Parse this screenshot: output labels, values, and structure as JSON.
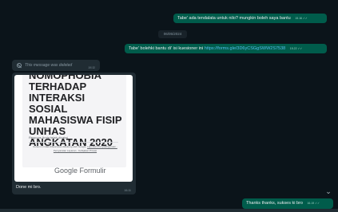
{
  "messages": {
    "out1": {
      "text": "Tabe' ada tendalata untuk nilo? mungkin boleh saya bantu",
      "time": "15.16 ✓✓"
    },
    "date_chip": "06/05/2024",
    "out2": {
      "text": "Tabe' bolehki bantu di' isi kuesioner ini ",
      "link": "https://forms.gle/3D6yCSGgSWW2S7538",
      "time": "15.22 ✓✓"
    },
    "deleted": {
      "text": "This message was deleted",
      "time": "16.11"
    },
    "form_preview": {
      "title": "NOMOPHOBIA TERHADAP INTERAKSI SOSIAL MAHASISWA FISIP UNHAS ANGKATAN 2020",
      "response_note": "Respons Anda telah dicatat",
      "fine_print": "Konten ini tidak dibuat atau didukung oleh Google. ",
      "fine_links": "Laporkan Penyalahgunaan - Persyaratan Layanan - Kebijakan Privasi",
      "brand_google": "Google",
      "brand_forms": "Formulir",
      "caption": "Done mi bro.",
      "time": "16.11"
    },
    "out3": {
      "text": "Thanks thanks, sukses ki bro",
      "time": "16.19 ✓✓"
    }
  },
  "icons": {
    "deleted": "ban-icon",
    "scroll": "chevron-down-icon"
  },
  "colors": {
    "outgoing": "#005c4b",
    "incoming": "#202c33",
    "background": "#0b141a",
    "link": "#53bdeb"
  }
}
